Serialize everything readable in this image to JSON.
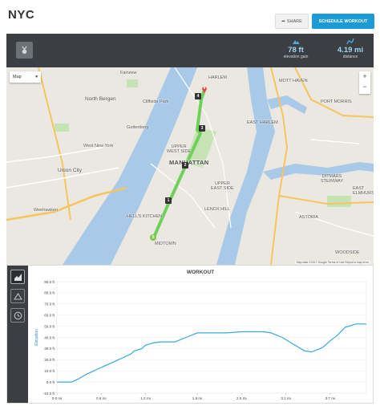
{
  "header": {
    "title": "NYC",
    "share_label": "SHARE",
    "schedule_label": "SCHEDULE WORKOUT"
  },
  "stats": {
    "elevation_value": "78 ft",
    "elevation_label": "elevation gain",
    "distance_value": "4.19 mi",
    "distance_label": "distance"
  },
  "map": {
    "map_type": "Map",
    "labels": {
      "harlem": "HARLEM",
      "east_harlem": "EAST HARLEM",
      "upper_west_side": "UPPER\nWEST SIDE",
      "manhattan": "MANHATTAN",
      "upper_east_side": "UPPER\nEAST SIDE",
      "lenox_hill": "LENOX HILL",
      "hells_kitchen": "HELL'S KITCHEN",
      "midtown": "MIDTOWN",
      "union_city": "Union City",
      "north_bergen": "North Bergen",
      "west_new_york": "West New York",
      "weehawken": "Weehawken",
      "fairview": "Fairview",
      "cliffside_park": "Cliffside Park",
      "guttenberg": "Guttenberg",
      "ditmars_steinway": "DITMARS\nSTEINWAY",
      "astoria": "ASTORIA",
      "port_morris": "PORT MORRIS",
      "mott_haven": "MOTT HAVEN",
      "woodside": "WOODSIDE",
      "east_elmhurst": "EAST\nELMHURST",
      "jackson_heights": "JACKSON"
    },
    "markers": [
      "1",
      "2",
      "3",
      "4"
    ],
    "start_marker": "S",
    "footer": "Map data ©2017 Google   Terms of Use   Report a map error",
    "route_color": "#6fd15a"
  },
  "chart_data": {
    "type": "line",
    "title": "WORKOUT",
    "xlabel": "",
    "ylabel": "Elevation",
    "ylim": [
      -10,
      90
    ],
    "y_ticks": [
      "90.0 ft",
      "80.0 ft",
      "70.0 ft",
      "60.0 ft",
      "50.0 ft",
      "40.0 ft",
      "30.0 ft",
      "20.0 ft",
      "10.0 ft",
      "0.0 ft",
      "-10.0 ft"
    ],
    "y_tick_values": [
      90,
      80,
      70,
      60,
      50,
      40,
      30,
      20,
      10,
      0,
      -10
    ],
    "x_ticks": [
      "0.0 mi",
      "0.6 mi",
      "1.2 mi",
      "1.9 mi",
      "2.5 mi",
      "3.1 mi",
      "3.7 mi"
    ],
    "x_tick_values": [
      0,
      0.6,
      1.2,
      1.9,
      2.5,
      3.1,
      3.7
    ],
    "xlim": [
      0,
      4.19
    ],
    "line_color": "#38a8dc",
    "x": [
      0,
      0.2,
      0.3,
      0.4,
      0.5,
      0.6,
      0.7,
      0.8,
      0.9,
      1.0,
      1.05,
      1.15,
      1.2,
      1.3,
      1.4,
      1.6,
      1.75,
      1.9,
      2.1,
      2.3,
      2.5,
      2.7,
      2.8,
      2.9,
      3.05,
      3.15,
      3.25,
      3.35,
      3.45,
      3.6,
      3.7,
      3.8,
      3.9,
      4.05,
      4.19
    ],
    "y": [
      0,
      0,
      3,
      7,
      10,
      13,
      16,
      19,
      22,
      25,
      28,
      30,
      33,
      35,
      36,
      36,
      40,
      44,
      44,
      44,
      45,
      45,
      45,
      44,
      40,
      36,
      32,
      28,
      27,
      31,
      37,
      42,
      49,
      52,
      52
    ]
  }
}
